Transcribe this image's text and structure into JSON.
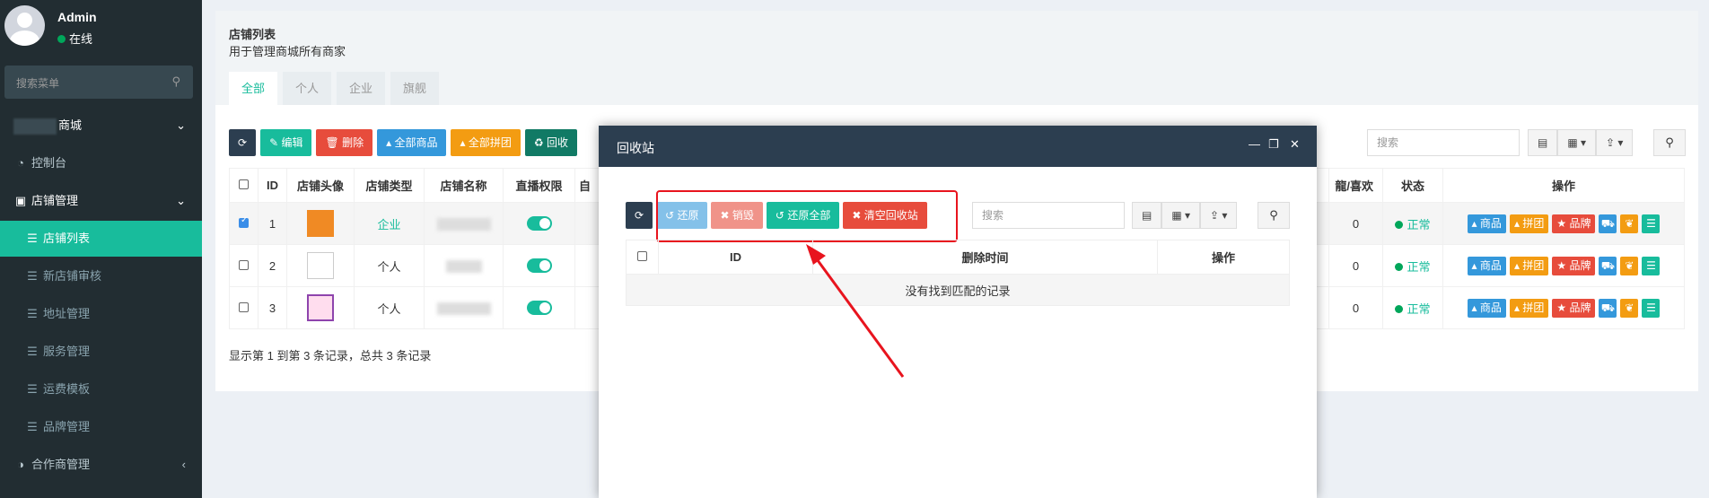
{
  "sidebar": {
    "user_name": "Admin",
    "user_status": "在线",
    "search_placeholder": "搜索菜单",
    "mall_label": "商城",
    "dashboard": "控制台",
    "store_mgmt": "店铺管理",
    "items": [
      "店铺列表",
      "新店铺审核",
      "地址管理",
      "服务管理",
      "运费模板",
      "品牌管理"
    ],
    "partner": "合作商管理"
  },
  "page": {
    "title": "店铺列表",
    "desc": "用于管理商城所有商家",
    "tabs": [
      "全部",
      "个人",
      "企业",
      "旗舰"
    ]
  },
  "toolbar": {
    "edit": "编辑",
    "delete": "删除",
    "all_goods": "全部商品",
    "all_group": "全部拼团",
    "recycle": "回收"
  },
  "search_placeholder": "搜索",
  "table": {
    "headers": [
      "ID",
      "店铺头像",
      "店铺类型",
      "店铺名称",
      "直播权限",
      "自",
      "龍/喜欢",
      "状态",
      "操作"
    ],
    "rows": [
      {
        "id": "1",
        "type": "企业",
        "likes": "0",
        "status": "正常"
      },
      {
        "id": "2",
        "type": "个人",
        "likes": "0",
        "status": "正常"
      },
      {
        "id": "3",
        "type": "个人",
        "likes": "0",
        "status": "正常"
      }
    ],
    "op_labels": {
      "goods": "商品",
      "group": "拼团",
      "brand": "品牌"
    }
  },
  "footer": "显示第 1 到第 3 条记录，总共 3 条记录",
  "modal": {
    "title": "回收站",
    "restore": "还原",
    "destroy": "销毁",
    "restore_all": "还原全部",
    "clear": "清空回收站",
    "search_placeholder": "搜索",
    "headers": [
      "ID",
      "删除时间",
      "操作"
    ],
    "empty": "没有找到匹配的记录"
  }
}
